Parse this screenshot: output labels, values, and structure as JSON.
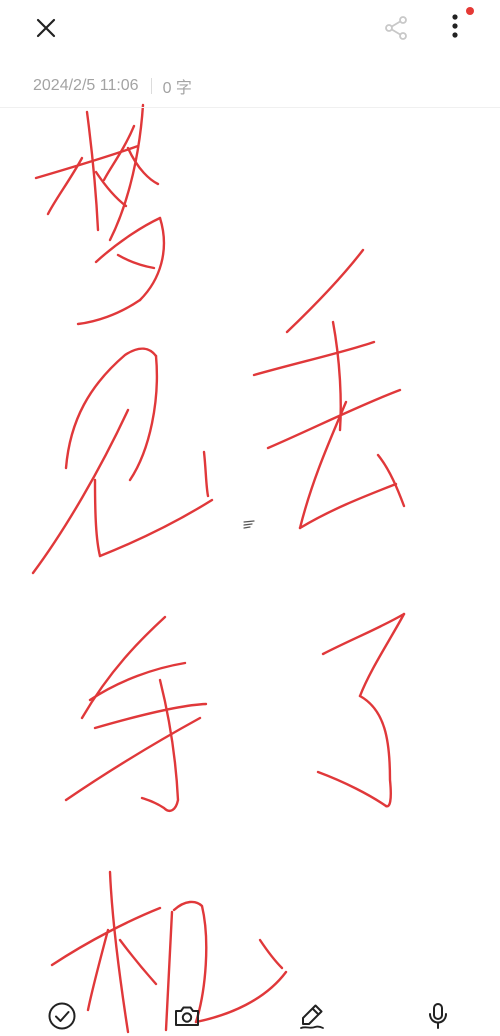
{
  "header": {
    "close_icon": "close-icon",
    "share_icon": "share-icon",
    "more_icon": "more-vertical-icon",
    "notification_dot_color": "#e53935"
  },
  "note": {
    "timestamp": "2024/2/5 11:06",
    "char_count": "0 字",
    "ink_color": "#e0383a"
  },
  "toolbar": {
    "items": [
      {
        "name": "checklist",
        "icon": "check-circle-icon"
      },
      {
        "name": "camera",
        "icon": "camera-icon"
      },
      {
        "name": "handwriting",
        "icon": "pen-icon"
      },
      {
        "name": "voice",
        "icon": "microphone-icon"
      }
    ]
  }
}
